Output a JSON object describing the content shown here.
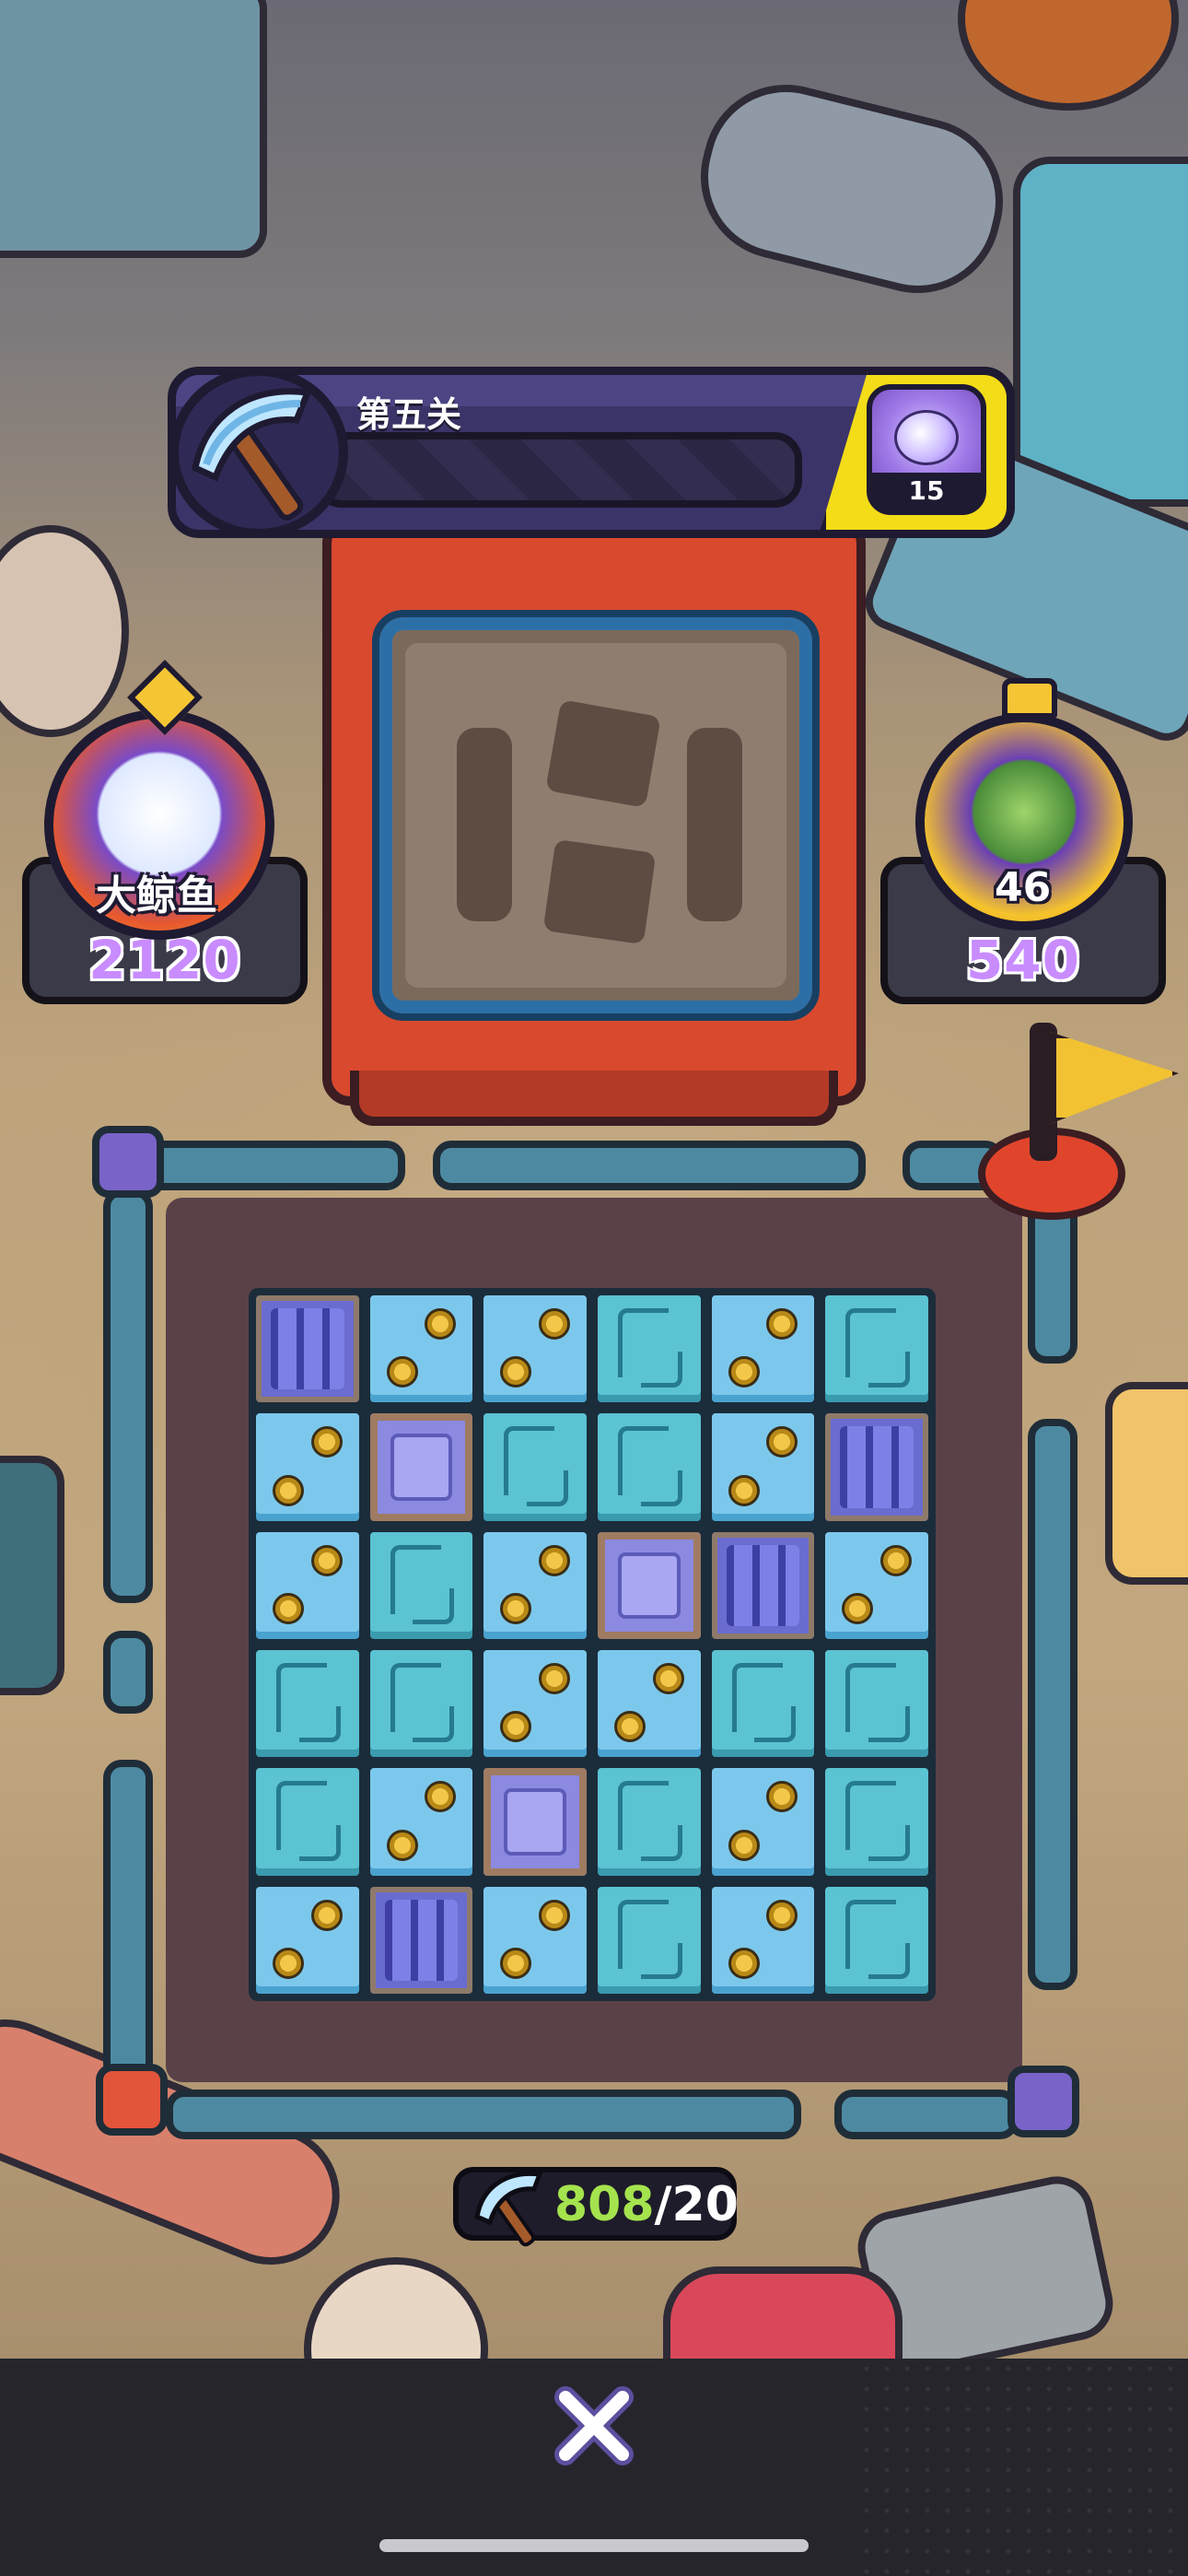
{
  "level": {
    "title": "第五关",
    "progress": 0.0,
    "reward_icon": "capsule-egg-icon",
    "reward_count": "15"
  },
  "players": {
    "left": {
      "name": "大鲸鱼",
      "score": "2120",
      "avatar_icon": "white-creature-avatar"
    },
    "right": {
      "name": "46",
      "score": "540",
      "avatar_icon": "green-frog-avatar"
    }
  },
  "board": {
    "rows": [
      [
        "bars",
        "bolt",
        "bolt",
        "pipe",
        "bolt",
        "pipe"
      ],
      [
        "bolt",
        "box",
        "pipe",
        "pipe",
        "bolt",
        "bars"
      ],
      [
        "bolt",
        "pipe",
        "bolt",
        "box",
        "bars",
        "bolt"
      ],
      [
        "pipe",
        "pipe",
        "bolt",
        "bolt",
        "pipe",
        "pipe"
      ],
      [
        "pipe",
        "bolt",
        "box",
        "pipe",
        "bolt",
        "pipe"
      ],
      [
        "bolt",
        "bars",
        "bolt",
        "pipe",
        "bolt",
        "pipe"
      ]
    ]
  },
  "pickaxes": {
    "current": "808",
    "separator": "/",
    "max": "20",
    "icon": "pickaxe-icon"
  },
  "controls": {
    "close_icon": "close-icon"
  },
  "colors": {
    "accent_yellow": "#f3dc18",
    "score_purple": "#c98cff",
    "counter_green": "#a4e34e",
    "tile_blue": "#7cc8ec"
  }
}
